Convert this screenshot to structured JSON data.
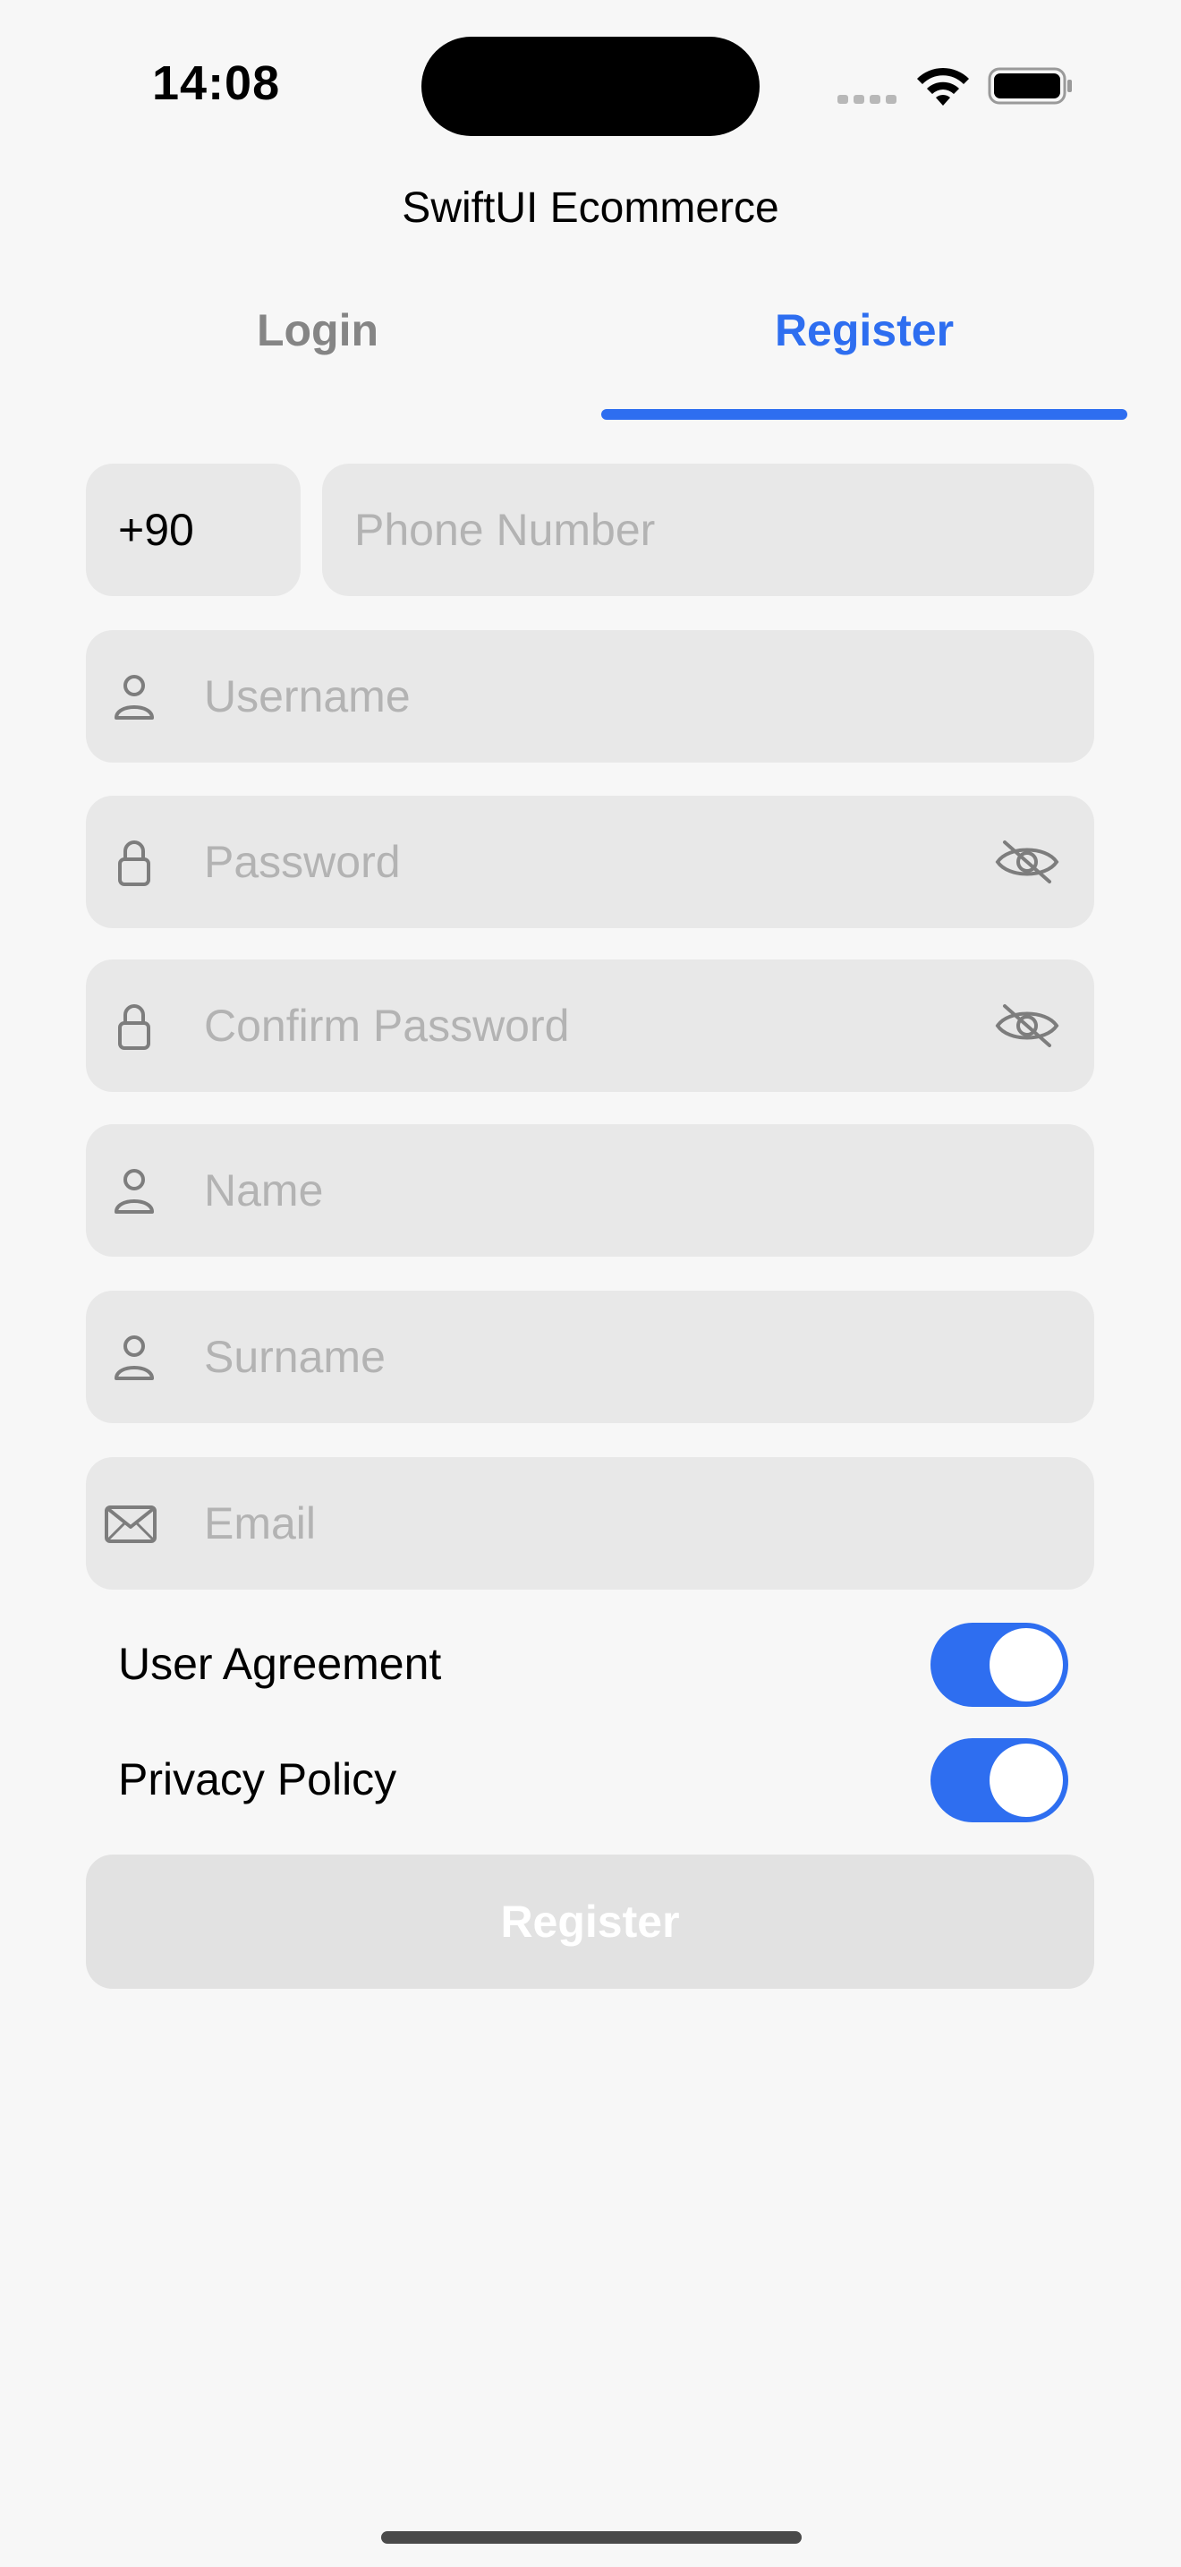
{
  "status_bar": {
    "time": "14:08"
  },
  "nav": {
    "title": "SwiftUI Ecommerce"
  },
  "tabs": [
    {
      "label": "Login",
      "selected": false
    },
    {
      "label": "Register",
      "selected": true
    }
  ],
  "form": {
    "country_code": "+90",
    "phone": {
      "placeholder": "Phone Number",
      "value": ""
    },
    "username": {
      "placeholder": "Username",
      "value": "",
      "icon": "person-icon"
    },
    "password": {
      "placeholder": "Password",
      "value": "",
      "icon": "lock-icon",
      "toggle_icon": "eye-slash-icon"
    },
    "confirm_password": {
      "placeholder": "Confirm Password",
      "value": "",
      "icon": "lock-icon",
      "toggle_icon": "eye-slash-icon"
    },
    "name": {
      "placeholder": "Name",
      "value": "",
      "icon": "person-icon"
    },
    "surname": {
      "placeholder": "Surname",
      "value": "",
      "icon": "person-icon"
    },
    "email": {
      "placeholder": "Email",
      "value": "",
      "icon": "envelope-icon"
    }
  },
  "toggles": [
    {
      "label": "User Agreement",
      "on": true
    },
    {
      "label": "Privacy Policy",
      "on": true
    }
  ],
  "register_button": {
    "label": "Register",
    "enabled": false
  },
  "colors": {
    "accent": "#2e6ef0",
    "background": "#f7f7f7",
    "field": "#e8e8e8",
    "disabled_button": "#e2e2e2"
  }
}
